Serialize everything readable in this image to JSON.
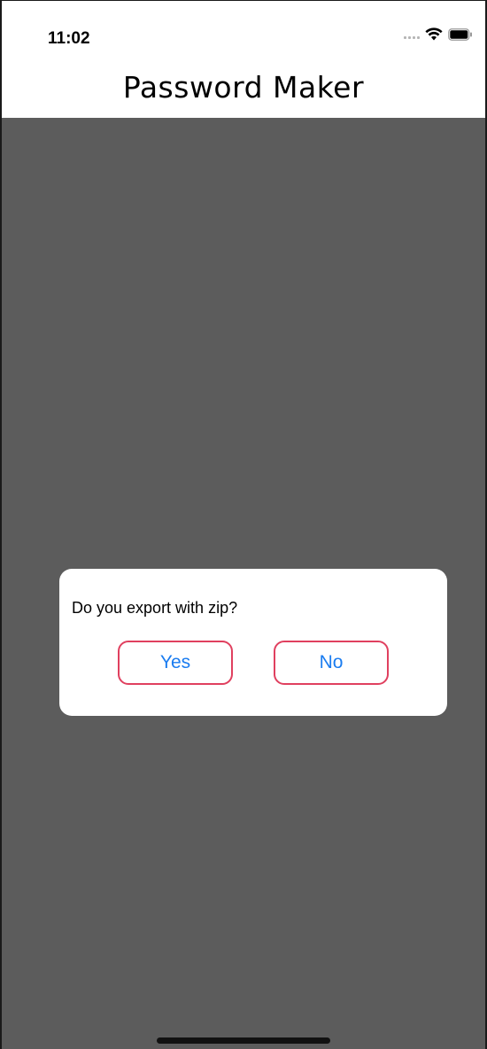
{
  "status_bar": {
    "time": "11:02",
    "icons": [
      "cellular-signal-icon",
      "wifi-icon",
      "battery-icon"
    ]
  },
  "nav": {
    "title": "Password Maker"
  },
  "dialog": {
    "message": "Do you export with zip?",
    "yes_label": "Yes",
    "no_label": "No"
  },
  "colors": {
    "overlay": "#5c5c5c",
    "button_border": "#e0405f",
    "button_text": "#1a7cf0"
  }
}
